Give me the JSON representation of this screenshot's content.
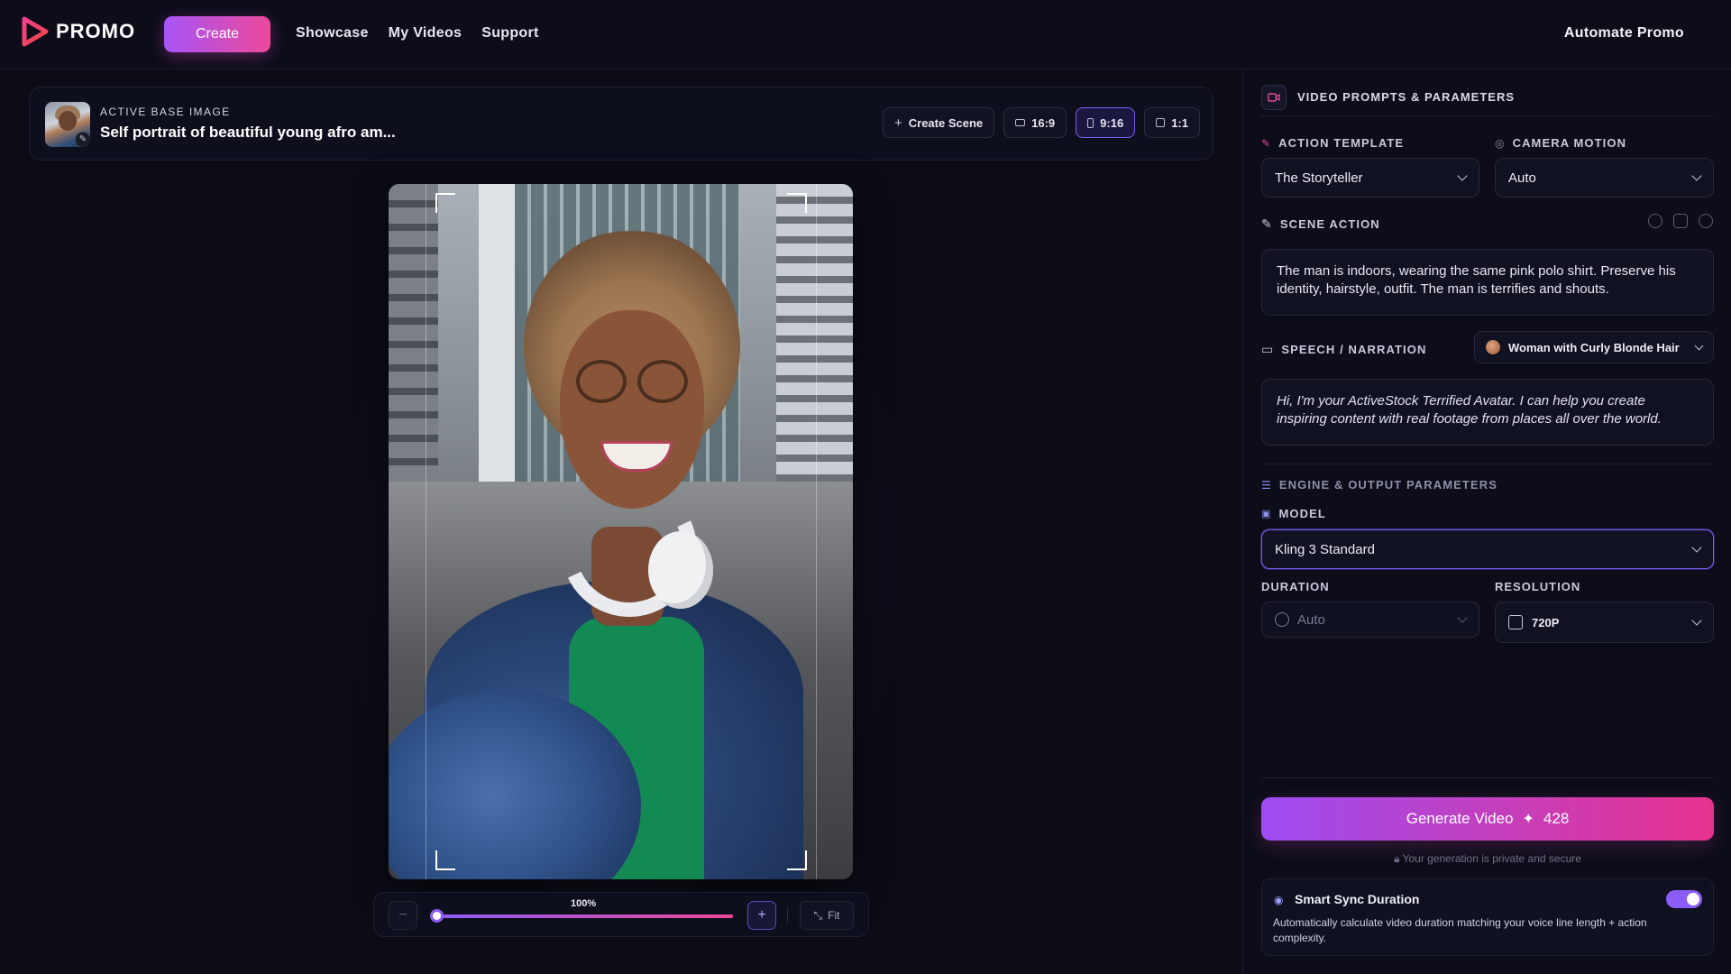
{
  "header": {
    "brand": "PROMO",
    "create_label": "Create",
    "nav": [
      "Showcase",
      "My Videos",
      "Support"
    ],
    "automate_label": "Automate Promo"
  },
  "active_image": {
    "label": "ACTIVE BASE IMAGE",
    "title": "Self portrait of beautiful young afro am...",
    "create_scene_label": "Create Scene",
    "ratios": [
      "16:9",
      "9:16",
      "1:1"
    ],
    "selected_ratio": "9:16"
  },
  "zoom": {
    "percent": "100%",
    "fit_label": "Fit",
    "minus_label": "−",
    "plus_label": "+"
  },
  "panel": {
    "title": "VIDEO PROMPTS & PARAMETERS",
    "action_template": {
      "label": "ACTION TEMPLATE",
      "value": "The Storyteller"
    },
    "camera_motion": {
      "label": "CAMERA MOTION",
      "value": "Auto"
    },
    "scene_action": {
      "label": "SCENE ACTION",
      "text": "The man is indoors, wearing the same pink polo shirt. Preserve his identity, hairstyle, outfit. The man is terrifies and shouts."
    },
    "speech": {
      "label": "SPEECH / NARRATION",
      "voice": "Woman with Curly Blonde Hair",
      "text": "Hi, I'm your ActiveStock Terrified Avatar. I can help you create inspiring content with real footage from places all over the world."
    },
    "engine_label": "ENGINE & OUTPUT PARAMETERS",
    "model": {
      "label": "MODEL",
      "value": "Kling 3 Standard"
    },
    "duration": {
      "label": "DURATION",
      "value": "Auto"
    },
    "resolution": {
      "label": "RESOLUTION",
      "value": "720P"
    },
    "generate": {
      "label": "Generate Video",
      "credits": "428"
    },
    "private_note": "Your generation is private and secure",
    "smart_sync": {
      "title": "Smart Sync Duration",
      "description": "Automatically calculate video duration matching your voice line length + action complexity.",
      "enabled": true
    }
  },
  "colors": {
    "accent_purple": "#8b5cf6",
    "accent_pink": "#ec4899",
    "background": "#0b0c16"
  }
}
